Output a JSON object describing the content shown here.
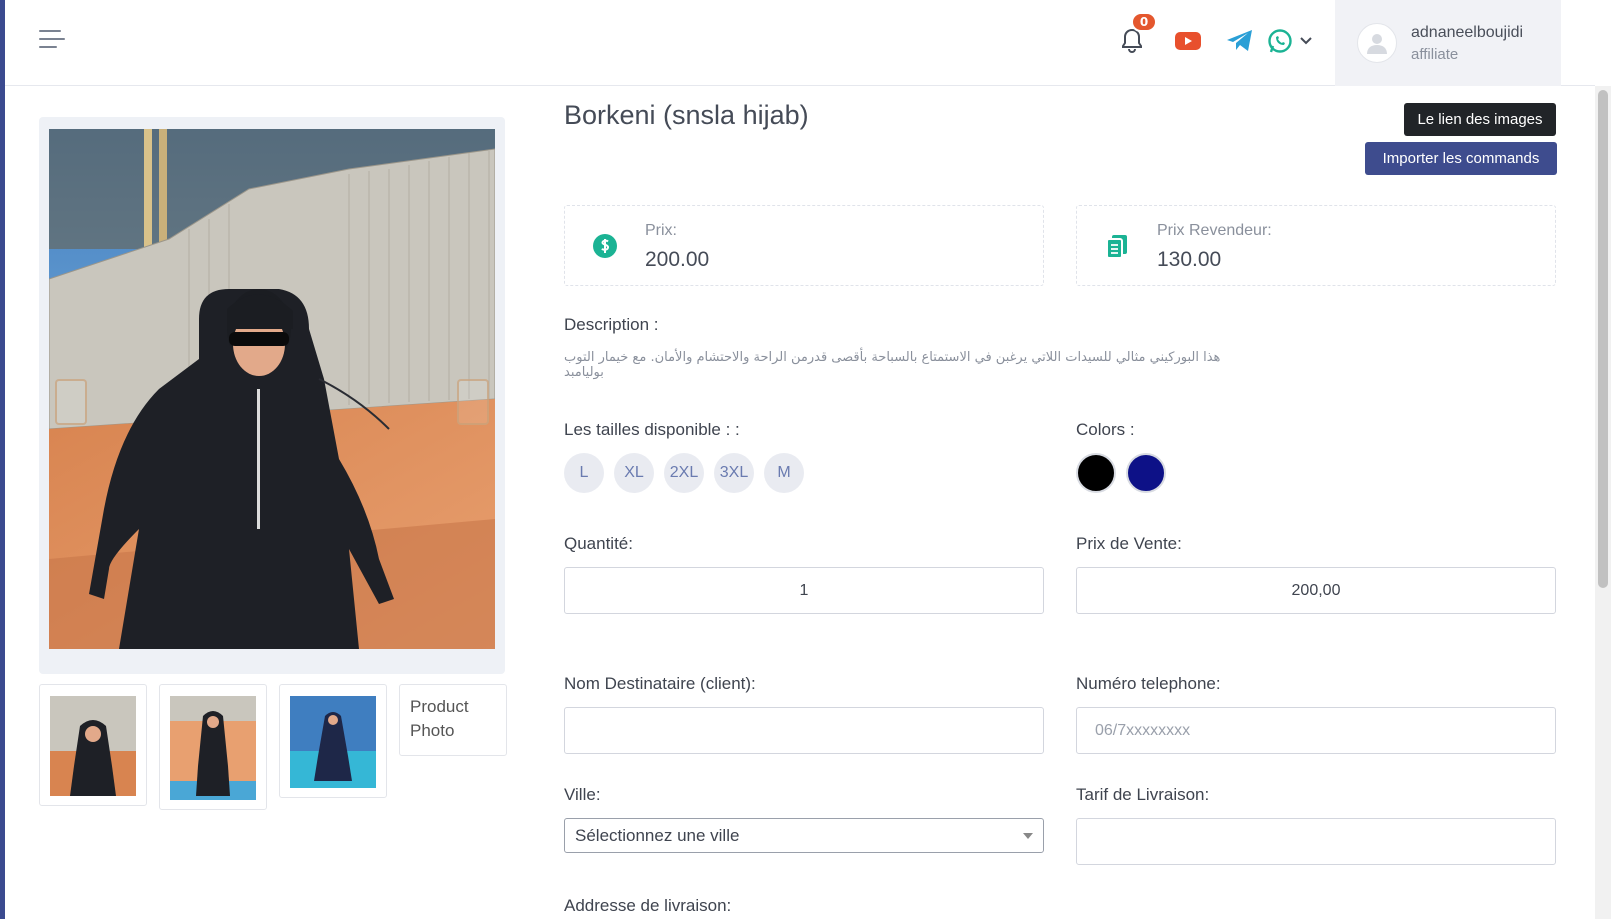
{
  "header": {
    "notification_count": "0",
    "user": {
      "name": "adnaneelboujidi",
      "role": "affiliate"
    },
    "icons": [
      "menu-icon",
      "bell-icon",
      "youtube-icon",
      "telegram-icon",
      "whatsapp-icon",
      "chevron-down-icon",
      "avatar-icon"
    ]
  },
  "gallery": {
    "broken_thumb_alt": "Product Photo"
  },
  "product": {
    "title": "Borkeni (snsla hijab)",
    "images_link_label": "Le lien des images",
    "import_orders_label": "Importer les commands",
    "price_label": "Prix:",
    "price_value": "200.00",
    "reseller_price_label": "Prix Revendeur:",
    "reseller_price_value": "130.00",
    "description_label": "Description :",
    "description_text": "هذا البوركيني مثالي للسيدات اللاتي يرغبن في الاستمتاع بالسباحة بأقصى قدرمن الراحة والاحتشام والأمان. مع خيمار التوب بوليامبد",
    "sizes_label": "Les tailles disponible : :",
    "sizes": [
      "L",
      "XL",
      "2XL",
      "3XL",
      "M"
    ],
    "colors_label": "Colors :",
    "colors": [
      "#000000",
      "#0d1187"
    ]
  },
  "form": {
    "quantity_label": "Quantité:",
    "quantity_value": "1",
    "sale_price_label": "Prix de Vente:",
    "sale_price_value": "200,00",
    "client_name_label": "Nom Destinataire (client):",
    "client_name_value": "",
    "phone_label": "Numéro telephone:",
    "phone_placeholder": "06/7xxxxxxxx",
    "city_label": "Ville:",
    "city_selected": "Sélectionnez une ville",
    "delivery_fee_label": "Tarif de Livraison:",
    "delivery_fee_value": "",
    "address_label": "Addresse de livraison:"
  },
  "colors": {
    "accent": "#3e4c8e",
    "dark_button": "#212428",
    "price_icon": "#1bb394",
    "badge": "#e4572e",
    "youtube": "#e8502d",
    "telegram": "#2a9fd6",
    "whatsapp": "#1bb394"
  }
}
